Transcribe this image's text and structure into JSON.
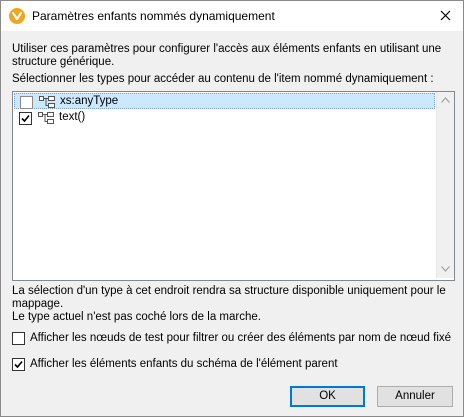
{
  "window": {
    "title": "Paramètres enfants nommés dynamiquement",
    "icon": "mapforce-app-icon",
    "close_icon": "close-icon"
  },
  "description": {
    "line1": "Utiliser ces paramètres pour configurer l'accès aux éléments enfants en utilisant une",
    "line2": "structure générique."
  },
  "list_label": "Sélectionner les types pour accéder au contenu de l'item nommé dynamiquement :",
  "types": [
    {
      "label": "xs:anyType",
      "checked": false,
      "selected": true
    },
    {
      "label": "text()",
      "checked": true,
      "selected": false
    }
  ],
  "info": {
    "line1": "La sélection d'un type à cet endroit rendra sa structure disponible uniquement pour le",
    "line2": "mappage.",
    "line3": "Le type actuel n'est pas coché lors de la marche."
  },
  "options": [
    {
      "label": "Afficher les nœuds de test pour filtrer ou créer des éléments par nom de nœud fixé",
      "checked": false
    },
    {
      "label": "Afficher les éléments enfants du schéma de l'élément parent",
      "checked": true
    }
  ],
  "buttons": {
    "ok": "OK",
    "cancel": "Annuler"
  },
  "colors": {
    "selection": "#cce8ff",
    "accent": "#0078d7",
    "app_icon": "#f2a51a"
  }
}
